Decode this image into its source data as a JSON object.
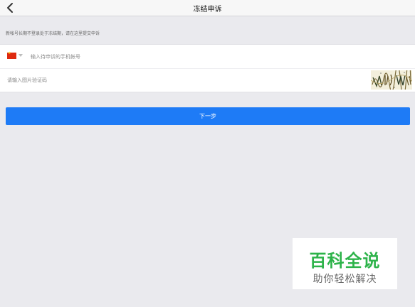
{
  "navbar": {
    "title": "冻结申诉",
    "back_icon": "chevron-left-icon"
  },
  "notice": {
    "text": "新帐号长期不登录处于冻结期，请在这里提交申诉"
  },
  "form": {
    "country": {
      "flag_icon": "china-flag-icon",
      "caret_icon": "caret-down-icon"
    },
    "phone": {
      "value": "",
      "placeholder": "输入待申诉的手机帐号"
    },
    "captcha": {
      "value": "",
      "placeholder": "请输入图片验证码",
      "image_icon": "captcha-image"
    }
  },
  "next_button": {
    "label": "下一步"
  },
  "watermark": {
    "title": "百科全说",
    "subtitle": "助你轻松解决"
  },
  "colors": {
    "accent": "#1e7bf6",
    "background": "#eaeaee",
    "watermark_green": "#2db34a"
  }
}
